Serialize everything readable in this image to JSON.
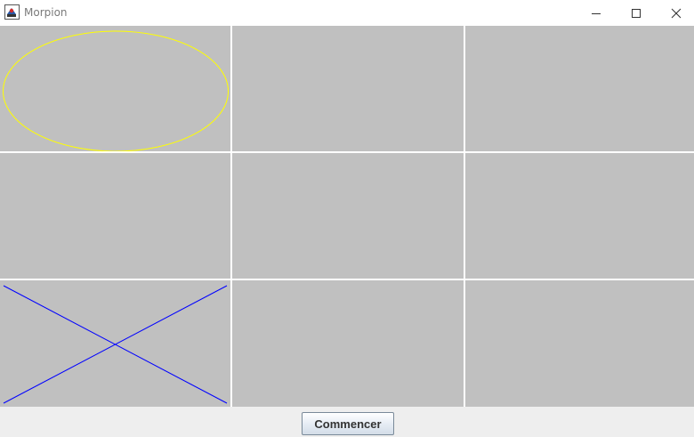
{
  "window": {
    "title": "Morpion",
    "icon": "java-cup-icon",
    "controls": [
      "minimize-icon",
      "maximize-icon",
      "close-icon"
    ]
  },
  "board": {
    "rows": 3,
    "cols": 3,
    "cell_color": "#c0c0c0",
    "grid_line_color": "#ffffff",
    "o_color": "#ffff00",
    "x_color": "#0000ff",
    "cells": [
      [
        "O",
        "",
        ""
      ],
      [
        "",
        "",
        ""
      ],
      [
        "X",
        "",
        ""
      ]
    ]
  },
  "controls": {
    "start_label": "Commencer"
  }
}
